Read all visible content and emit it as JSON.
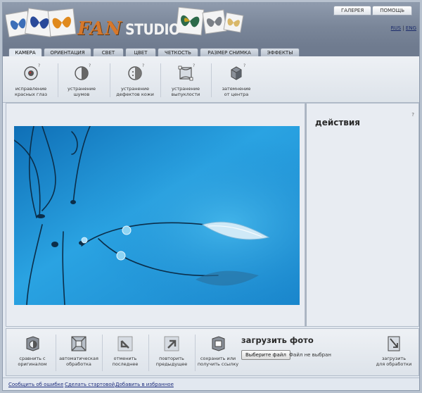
{
  "header": {
    "logo_fan": "FAN",
    "logo_studio": "STUDIO",
    "top_tabs": [
      "ГАЛЕРЕЯ",
      "ПОМОЩЬ"
    ],
    "lang_rus": "RUS",
    "lang_sep": "|",
    "lang_eng": "ENG"
  },
  "tabs": [
    "КАМЕРА",
    "ОРИЕНТАЦИЯ",
    "СВЕТ",
    "ЦВЕТ",
    "ЧЕТКОСТЬ",
    "РАЗМЕР СНИМКА",
    "ЭФФЕКТЫ"
  ],
  "active_tab": "КАМЕРА",
  "tools": [
    {
      "label": "исправление\nкрасных глаз",
      "icon": "red-eye-icon"
    },
    {
      "label": "устранение\nшумов",
      "icon": "noise-icon"
    },
    {
      "label": "устранение\nдефектов кожи",
      "icon": "skin-icon"
    },
    {
      "label": "устранение\nвыпуклости",
      "icon": "bulge-icon"
    },
    {
      "label": "затемнение\nот центра",
      "icon": "vignette-icon"
    }
  ],
  "help_mark": "?",
  "side": {
    "title": "действия",
    "help": "?"
  },
  "bottom_tools": [
    {
      "label": "сравнить с\nоригиналом",
      "icon": "compare-icon"
    },
    {
      "label": "автоматическая\nобработка",
      "icon": "auto-icon"
    },
    {
      "label": "отменить\nпоследнее",
      "icon": "undo-icon"
    },
    {
      "label": "повторить\nпредыдущее",
      "icon": "redo-icon"
    },
    {
      "label": "сохранить или\nполучить ссылку",
      "icon": "save-icon"
    }
  ],
  "upload": {
    "title": "загрузить фото",
    "button": "Выберите файл",
    "status": "Файл не выбран",
    "load_label": "загрузить\nдля обработки"
  },
  "footer": {
    "links": [
      "Сообщить об ошибке",
      "Сделать стартовой",
      "Добавить в избранное"
    ]
  },
  "colors": {
    "accent_logo": "#d7782b",
    "header": "#7a8699",
    "panel": "#e2e8f0",
    "photo_blue": "#1e9ad8"
  }
}
